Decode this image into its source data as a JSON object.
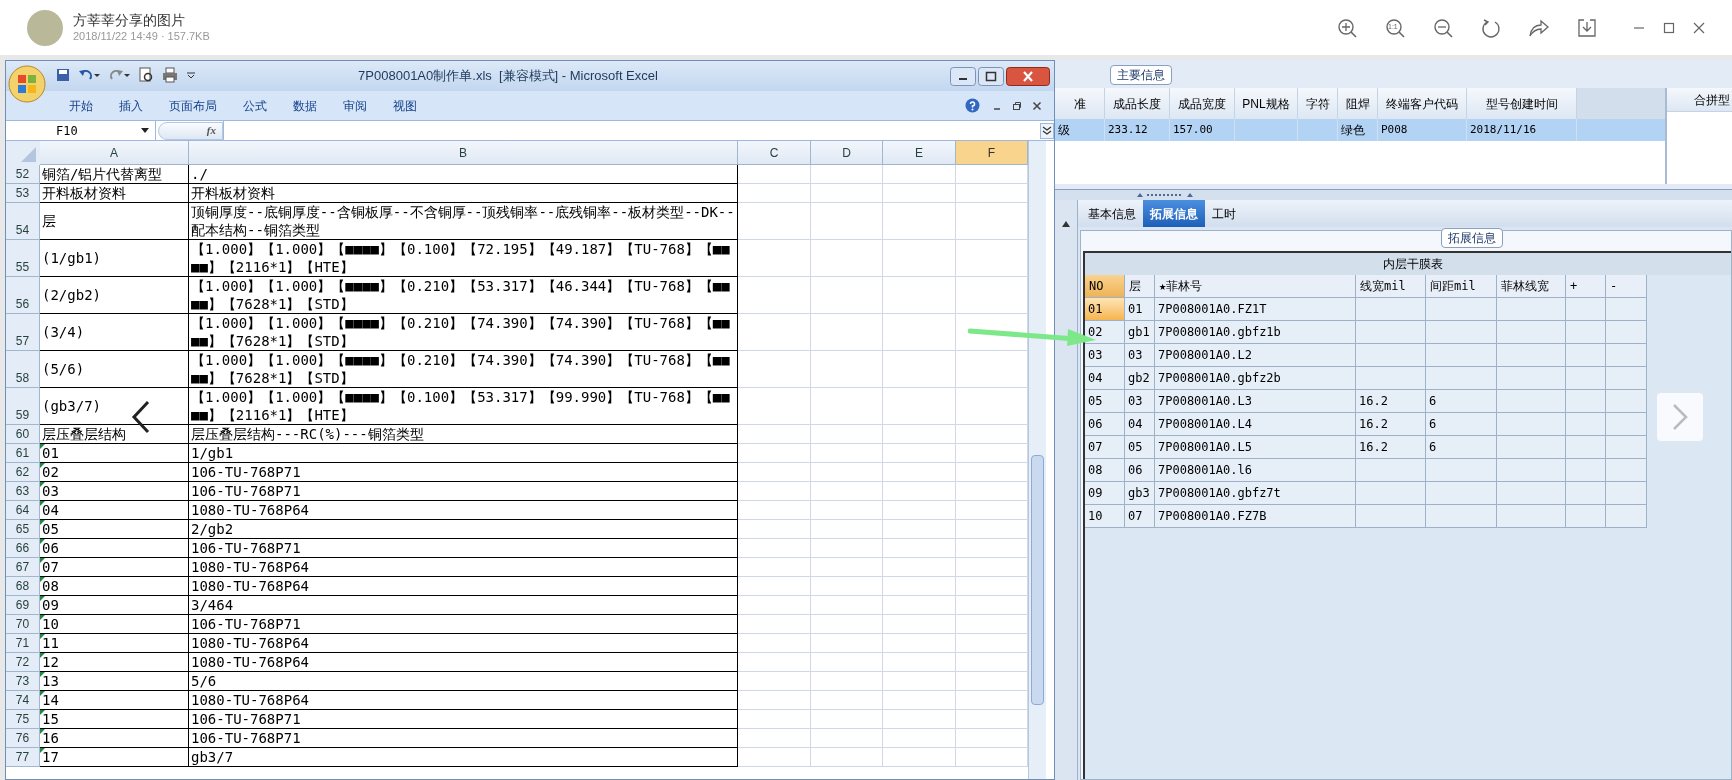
{
  "viewer": {
    "title": "方莘莘分享的图片",
    "subtitle": "2018/11/22 14:49 · 157.7KB",
    "actual_size_label": "1:1"
  },
  "excel": {
    "title": "7P008001A0制作单.xls  [兼容模式] - Microsoft Excel",
    "ribbon_tabs": [
      "开始",
      "插入",
      "页面布局",
      "公式",
      "数据",
      "审阅",
      "视图"
    ],
    "name_box": "F10",
    "formula_label": "fx",
    "columns": [
      {
        "label": "A",
        "selected": false
      },
      {
        "label": "B",
        "selected": false
      },
      {
        "label": "C",
        "selected": false
      },
      {
        "label": "D",
        "selected": false
      },
      {
        "label": "E",
        "selected": false
      },
      {
        "label": "F",
        "selected": true
      }
    ],
    "rows": [
      {
        "num": "52",
        "a": "铜箔/铝片代替离型",
        "b": "./",
        "error_mark": false
      },
      {
        "num": "53",
        "a": "开料板材资料",
        "b": "开料板材资料",
        "error_mark": false
      },
      {
        "num": "54",
        "a": "层",
        "b": "顶铜厚度--底铜厚度--含铜板厚--不含铜厚--顶残铜率--底残铜率--板材类型--DK--配本结构--铜箔类型",
        "error_mark": false
      },
      {
        "num": "55",
        "a": "(1/gb1)",
        "b": "【1.000】【1.000】【■■■■】【0.100】【72.195】【49.187】【TU-768】【■■■■】【2116*1】【HTE】",
        "error_mark": false
      },
      {
        "num": "56",
        "a": "(2/gb2)",
        "b": "【1.000】【1.000】【■■■■】【0.210】【53.317】【46.344】【TU-768】【■■■■】【7628*1】【STD】",
        "error_mark": false
      },
      {
        "num": "57",
        "a": "(3/4)",
        "b": "【1.000】【1.000】【■■■■】【0.210】【74.390】【74.390】【TU-768】【■■■■】【7628*1】【STD】",
        "error_mark": false
      },
      {
        "num": "58",
        "a": "(5/6)",
        "b": "【1.000】【1.000】【■■■■】【0.210】【74.390】【74.390】【TU-768】【■■■■】【7628*1】【STD】",
        "error_mark": false
      },
      {
        "num": "59",
        "a": "(gb3/7)",
        "b": "【1.000】【1.000】【■■■■】【0.100】【53.317】【99.990】【TU-768】【■■■■】【2116*1】【HTE】",
        "error_mark": false
      },
      {
        "num": "60",
        "a": "层压叠层结构",
        "b": "层压叠层结构---RC(%)---铜箔类型",
        "error_mark": false
      },
      {
        "num": "61",
        "a": "01",
        "b": "1/gb1",
        "error_mark": true
      },
      {
        "num": "62",
        "a": "02",
        "b": "106-TU-768P71",
        "error_mark": true
      },
      {
        "num": "63",
        "a": "03",
        "b": "106-TU-768P71",
        "error_mark": true
      },
      {
        "num": "64",
        "a": "04",
        "b": "1080-TU-768P64",
        "error_mark": true
      },
      {
        "num": "65",
        "a": "05",
        "b": "2/gb2",
        "error_mark": true
      },
      {
        "num": "66",
        "a": "06",
        "b": "106-TU-768P71",
        "error_mark": true
      },
      {
        "num": "67",
        "a": "07",
        "b": "1080-TU-768P64",
        "error_mark": true
      },
      {
        "num": "68",
        "a": "08",
        "b": "1080-TU-768P64",
        "error_mark": true
      },
      {
        "num": "69",
        "a": "09",
        "b": "3/464",
        "error_mark": true
      },
      {
        "num": "70",
        "a": "10",
        "b": "106-TU-768P71",
        "error_mark": true
      },
      {
        "num": "71",
        "a": "11",
        "b": "1080-TU-768P64",
        "error_mark": true
      },
      {
        "num": "72",
        "a": "12",
        "b": "1080-TU-768P64",
        "error_mark": true
      },
      {
        "num": "73",
        "a": "13",
        "b": "5/6",
        "error_mark": true
      },
      {
        "num": "74",
        "a": "14",
        "b": "1080-TU-768P64",
        "error_mark": true
      },
      {
        "num": "75",
        "a": "15",
        "b": "106-TU-768P71",
        "error_mark": true
      },
      {
        "num": "76",
        "a": "16",
        "b": "106-TU-768P71",
        "error_mark": true
      },
      {
        "num": "77",
        "a": "17",
        "b": "gb3/7",
        "error_mark": true
      }
    ]
  },
  "main_info": {
    "legend": "主要信息",
    "columns": [
      "准",
      "成品长度",
      "成品宽度",
      "PNL规格",
      "字符",
      "阻焊",
      "终端客户代码",
      "型号创建时间"
    ],
    "rows": [
      {
        "cells": [
          "级",
          "233.12",
          "157.00",
          null,
          null,
          "绿色",
          "P008",
          "2018/11/16"
        ],
        "selected": true
      }
    ]
  },
  "side_panel": {
    "header": "合拼型"
  },
  "tabs": [
    {
      "label": "基本信息",
      "selected": false
    },
    {
      "label": "拓展信息",
      "selected": true
    },
    {
      "label": "工时",
      "selected": false
    }
  ],
  "ext_info": {
    "legend": "拓展信息"
  },
  "film_table": {
    "title": "内层干膜表",
    "columns": [
      "NO",
      "层",
      "★菲林号",
      "线宽mil",
      "间距mil",
      "菲林线宽",
      "+",
      "-"
    ],
    "rows": [
      {
        "cells": [
          "01",
          "01",
          "7P008001A0.FZ1T",
          null,
          null,
          null,
          null,
          null
        ],
        "selected": true
      },
      {
        "cells": [
          "02",
          "gb1",
          "7P008001A0.gbfz1b",
          null,
          null,
          null,
          null,
          null
        ],
        "selected": false
      },
      {
        "cells": [
          "03",
          "03",
          "7P008001A0.L2",
          null,
          null,
          null,
          null,
          null
        ],
        "selected": false
      },
      {
        "cells": [
          "04",
          "gb2",
          "7P008001A0.gbfz2b",
          null,
          null,
          null,
          null,
          null
        ],
        "selected": false
      },
      {
        "cells": [
          "05",
          "03",
          "7P008001A0.L3",
          "16.2",
          "6",
          null,
          null,
          null
        ],
        "selected": false
      },
      {
        "cells": [
          "06",
          "04",
          "7P008001A0.L4",
          "16.2",
          "6",
          null,
          null,
          null
        ],
        "selected": false
      },
      {
        "cells": [
          "07",
          "05",
          "7P008001A0.L5",
          "16.2",
          "6",
          null,
          null,
          null
        ],
        "selected": false
      },
      {
        "cells": [
          "08",
          "06",
          "7P008001A0.l6",
          null,
          null,
          null,
          null,
          null
        ],
        "selected": false
      },
      {
        "cells": [
          "09",
          "gb3",
          "7P008001A0.gbfz7t",
          null,
          null,
          null,
          null,
          null
        ],
        "selected": false
      },
      {
        "cells": [
          "10",
          "07",
          "7P008001A0.FZ7B",
          null,
          null,
          null,
          null,
          null
        ],
        "selected": false
      }
    ]
  }
}
